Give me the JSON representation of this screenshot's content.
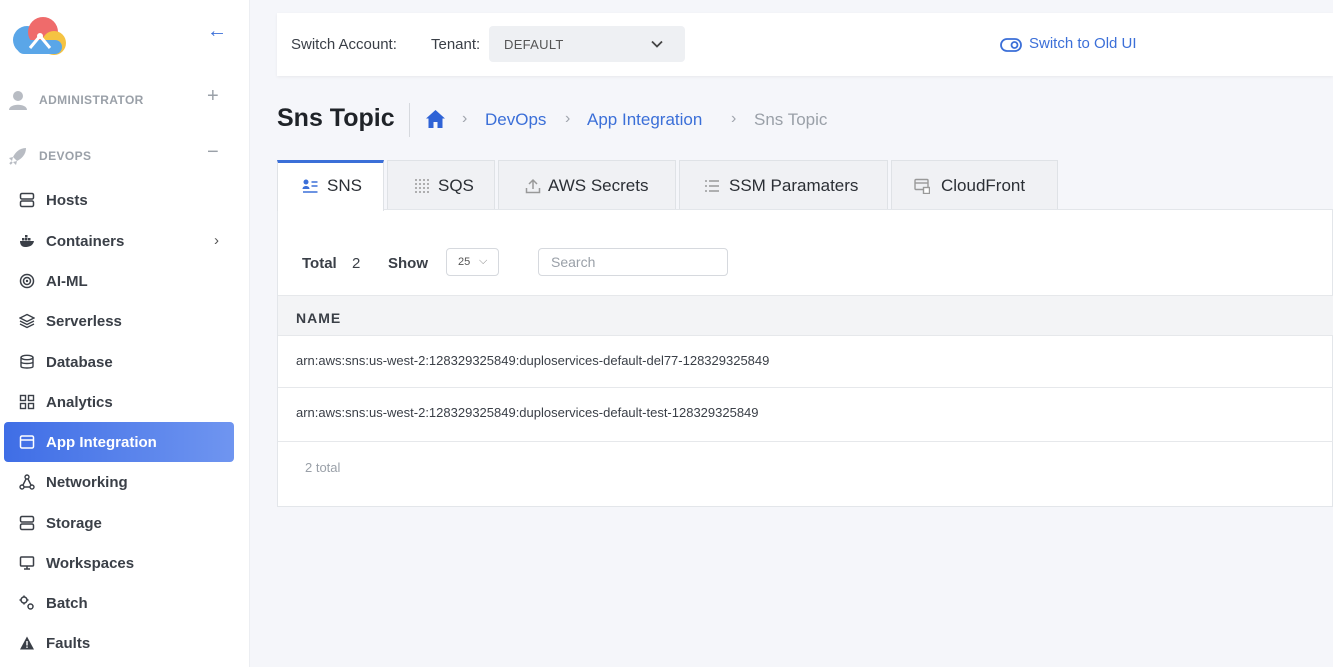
{
  "sidebar": {
    "sections": [
      {
        "label": "ADMINISTRATOR",
        "icon": "user-icon",
        "toggle": "+"
      },
      {
        "label": "DEVOPS",
        "icon": "rocket-icon",
        "toggle": "−"
      }
    ],
    "collapse_icon": "←",
    "items": [
      {
        "label": "Hosts",
        "icon": "server-icon"
      },
      {
        "label": "Containers",
        "icon": "docker-icon",
        "chevron": "›"
      },
      {
        "label": "AI-ML",
        "icon": "target-icon"
      },
      {
        "label": "Serverless",
        "icon": "layers-icon"
      },
      {
        "label": "Database",
        "icon": "database-icon"
      },
      {
        "label": "Analytics",
        "icon": "grid-icon"
      },
      {
        "label": "App Integration",
        "icon": "window-icon",
        "active": true
      },
      {
        "label": "Networking",
        "icon": "network-icon"
      },
      {
        "label": "Storage",
        "icon": "storage-icon"
      },
      {
        "label": "Workspaces",
        "icon": "monitor-icon"
      },
      {
        "label": "Batch",
        "icon": "cogs-icon"
      },
      {
        "label": "Faults",
        "icon": "warning-icon"
      }
    ]
  },
  "topbar": {
    "switch_account": "Switch Account:",
    "tenant_label": "Tenant:",
    "tenant_value": "DEFAULT",
    "old_ui": "Switch to Old UI"
  },
  "page": {
    "title": "Sns Topic",
    "breadcrumb": [
      "DevOps",
      "App Integration"
    ],
    "breadcrumb_current": "Sns Topic",
    "breadcrumb_sep": "›"
  },
  "tabs": [
    {
      "label": "SNS",
      "icon": "list-user-icon",
      "active": true
    },
    {
      "label": "SQS",
      "icon": "dots-grid-icon"
    },
    {
      "label": "AWS Secrets",
      "icon": "upload-icon"
    },
    {
      "label": "SSM Paramaters",
      "icon": "list-icon"
    },
    {
      "label": "CloudFront",
      "icon": "cloudfront-icon"
    }
  ],
  "table": {
    "total_label": "Total",
    "total_value": "2",
    "show_label": "Show",
    "page_size": "25",
    "search_placeholder": "Search",
    "column": "NAME",
    "rows": [
      "arn:aws:sns:us-west-2:128329325849:duploservices-default-del77-128329325849",
      "arn:aws:sns:us-west-2:128329325849:duploservices-default-test-128329325849"
    ],
    "footer": "2 total"
  },
  "colors": {
    "accent": "#3b6fd8",
    "active_gradient_start": "#3f6ee6",
    "active_gradient_end": "#6f95f0"
  }
}
